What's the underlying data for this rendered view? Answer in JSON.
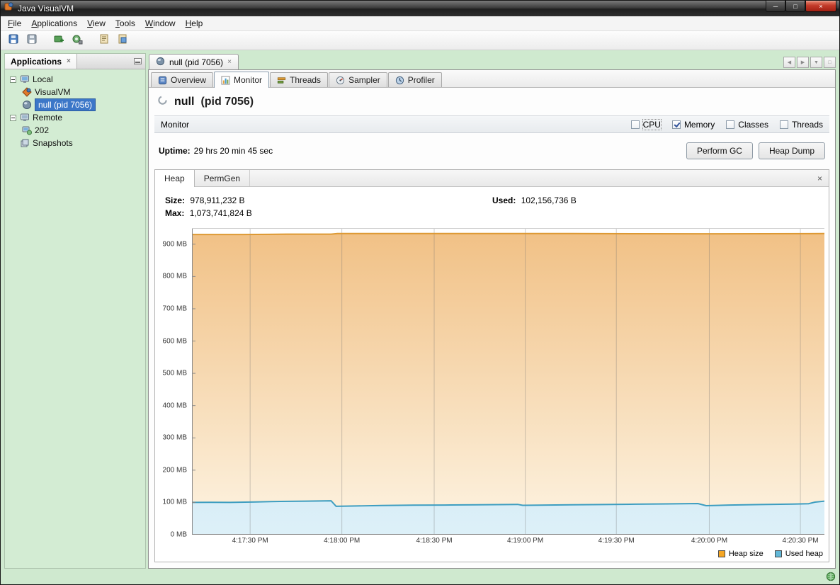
{
  "window": {
    "title": "Java VisualVM"
  },
  "icons": {
    "minimize": "─",
    "maximize": "□",
    "close": "×",
    "nav_left": "◀",
    "nav_right": "▶",
    "dropdown": "▼"
  },
  "menu": {
    "items": [
      "File",
      "Applications",
      "View",
      "Tools",
      "Window",
      "Help"
    ]
  },
  "sidebar": {
    "title": "Applications",
    "tree": [
      {
        "label": "Local",
        "selected": false
      },
      {
        "label": "VisualVM",
        "selected": false
      },
      {
        "label": "null (pid 7056)",
        "selected": true
      },
      {
        "label": "Remote",
        "selected": false
      },
      {
        "label": "202",
        "selected": false
      },
      {
        "label": "Snapshots",
        "selected": false
      }
    ]
  },
  "main": {
    "document_tab": "null (pid 7056)",
    "tabs": [
      "Overview",
      "Monitor",
      "Threads",
      "Sampler",
      "Profiler"
    ],
    "heading": {
      "name": "null",
      "pid": "(pid 7056)"
    },
    "monitor": {
      "label": "Monitor",
      "checkboxes": [
        {
          "label": "CPU",
          "checked": false
        },
        {
          "label": "Memory",
          "checked": true
        },
        {
          "label": "Classes",
          "checked": false
        },
        {
          "label": "Threads",
          "checked": false
        }
      ]
    },
    "uptime": {
      "label": "Uptime:",
      "value": "29 hrs 20 min 45 sec"
    },
    "actions": [
      {
        "label": "Perform GC"
      },
      {
        "label": "Heap Dump"
      }
    ],
    "memory_tabs": [
      "Heap",
      "PermGen"
    ],
    "stats": {
      "size_label": "Size:",
      "size_value": "978,911,232 B",
      "used_label": "Used:",
      "used_value": "102,156,736 B",
      "max_label": "Max:",
      "max_value": "1,073,741,824 B"
    }
  },
  "chart_data": {
    "type": "area",
    "title": "Heap",
    "y_max_mb": 950,
    "grid": true,
    "legend_position": "bottom-right",
    "x_ticks": [
      {
        "label": "4:17:30 PM",
        "f": 0.092
      },
      {
        "label": "4:18:00 PM",
        "f": 0.237
      },
      {
        "label": "4:18:30 PM",
        "f": 0.383
      },
      {
        "label": "4:19:00 PM",
        "f": 0.527
      },
      {
        "label": "4:19:30 PM",
        "f": 0.671
      },
      {
        "label": "4:20:00 PM",
        "f": 0.818
      },
      {
        "label": "4:20:30 PM",
        "f": 0.962
      }
    ],
    "y_ticks": [
      {
        "label": "0 MB",
        "mb": 0
      },
      {
        "label": "100 MB",
        "mb": 100
      },
      {
        "label": "200 MB",
        "mb": 200
      },
      {
        "label": "300 MB",
        "mb": 300
      },
      {
        "label": "400 MB",
        "mb": 400
      },
      {
        "label": "500 MB",
        "mb": 500
      },
      {
        "label": "600 MB",
        "mb": 600
      },
      {
        "label": "700 MB",
        "mb": 700
      },
      {
        "label": "800 MB",
        "mb": 800
      },
      {
        "label": "900 MB",
        "mb": 900
      }
    ],
    "series": [
      {
        "name": "Heap size",
        "stroke": "#dd9933",
        "fill_top": "#f1c186",
        "fill_bottom": "#fdf4e3",
        "points": [
          [
            0,
            930
          ],
          [
            0.08,
            930
          ],
          [
            0.15,
            931
          ],
          [
            0.22,
            931
          ],
          [
            0.23,
            933
          ],
          [
            0.45,
            933
          ],
          [
            0.6,
            933
          ],
          [
            0.8,
            932
          ],
          [
            1,
            933
          ]
        ]
      },
      {
        "name": "Used heap",
        "stroke": "#3d9dc0",
        "fill_top": "#d9eef7",
        "fill_bottom": "#ddf0f8",
        "points": [
          [
            0,
            100
          ],
          [
            0.03,
            100.5
          ],
          [
            0.06,
            100
          ],
          [
            0.1,
            101.5
          ],
          [
            0.14,
            103
          ],
          [
            0.18,
            104
          ],
          [
            0.22,
            105
          ],
          [
            0.228,
            88
          ],
          [
            0.26,
            89
          ],
          [
            0.3,
            90.5
          ],
          [
            0.35,
            91.5
          ],
          [
            0.4,
            92
          ],
          [
            0.45,
            92.5
          ],
          [
            0.5,
            93.5
          ],
          [
            0.515,
            94
          ],
          [
            0.523,
            91
          ],
          [
            0.55,
            91.5
          ],
          [
            0.6,
            92.5
          ],
          [
            0.65,
            93.5
          ],
          [
            0.7,
            94.5
          ],
          [
            0.75,
            95.5
          ],
          [
            0.8,
            96.5
          ],
          [
            0.813,
            90
          ],
          [
            0.85,
            92
          ],
          [
            0.9,
            93.5
          ],
          [
            0.95,
            95
          ],
          [
            0.975,
            96
          ],
          [
            0.985,
            101
          ],
          [
            1,
            104
          ]
        ]
      }
    ],
    "legend": [
      {
        "label": "Heap size",
        "color": "#f5a623"
      },
      {
        "label": "Used heap",
        "color": "#62b8d8"
      }
    ]
  }
}
